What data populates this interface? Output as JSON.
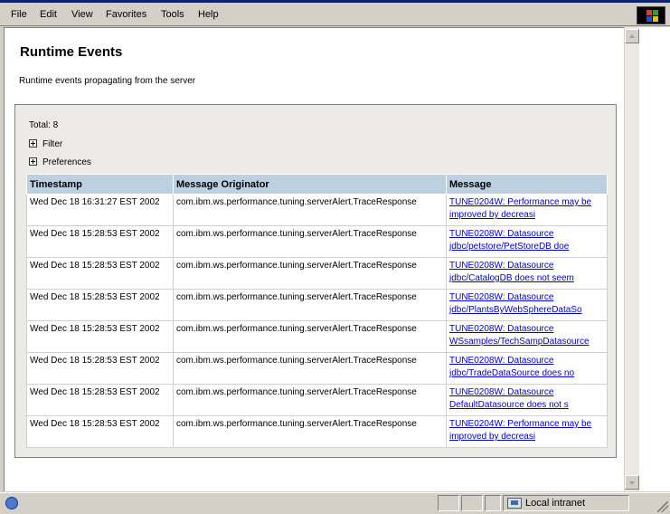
{
  "menu": {
    "file": "File",
    "edit": "Edit",
    "view": "View",
    "favorites": "Favorites",
    "tools": "Tools",
    "help": "Help"
  },
  "page": {
    "title": "Runtime Events",
    "description": "Runtime events propagating from the server"
  },
  "panel": {
    "total": "Total: 8",
    "filter_label": "Filter",
    "preferences_label": "Preferences"
  },
  "table": {
    "headers": [
      "Timestamp",
      "Message Originator",
      "Message"
    ],
    "rows": [
      {
        "timestamp": "Wed Dec 18 16:31:27 EST 2002",
        "originator": "com.ibm.ws.performance.tuning.serverAlert.TraceResponse",
        "message": "TUNE0204W: Performance may be improved by decreasi"
      },
      {
        "timestamp": "Wed Dec 18 15:28:53 EST 2002",
        "originator": "com.ibm.ws.performance.tuning.serverAlert.TraceResponse",
        "message": "TUNE0208W: Datasource jdbc/petstore/PetStoreDB doe"
      },
      {
        "timestamp": "Wed Dec 18 15:28:53 EST 2002",
        "originator": "com.ibm.ws.performance.tuning.serverAlert.TraceResponse",
        "message": "TUNE0208W: Datasource jdbc/CatalogDB does not seem"
      },
      {
        "timestamp": "Wed Dec 18 15:28:53 EST 2002",
        "originator": "com.ibm.ws.performance.tuning.serverAlert.TraceResponse",
        "message": "TUNE0208W: Datasource jdbc/PlantsByWebSphereDataSo"
      },
      {
        "timestamp": "Wed Dec 18 15:28:53 EST 2002",
        "originator": "com.ibm.ws.performance.tuning.serverAlert.TraceResponse",
        "message": "TUNE0208W: Datasource WSsamples/TechSampDatasource"
      },
      {
        "timestamp": "Wed Dec 18 15:28:53 EST 2002",
        "originator": "com.ibm.ws.performance.tuning.serverAlert.TraceResponse",
        "message": "TUNE0208W: Datasource jdbc/TradeDataSource does no"
      },
      {
        "timestamp": "Wed Dec 18 15:28:53 EST 2002",
        "originator": "com.ibm.ws.performance.tuning.serverAlert.TraceResponse",
        "message": "TUNE0208W: Datasource DefaultDatasource does not s"
      },
      {
        "timestamp": "Wed Dec 18 15:28:53 EST 2002",
        "originator": "com.ibm.ws.performance.tuning.serverAlert.TraceResponse",
        "message": "TUNE0204W: Performance may be improved by decreasi"
      }
    ]
  },
  "status": {
    "zone": "Local intranet"
  },
  "icons": {
    "browser_logo": "windows-flag-icon",
    "page_status": "ie-page-icon",
    "zone": "intranet-zone-icon",
    "expand": "plus-box-icon"
  },
  "colors": {
    "header_bg": "#bcd0e0",
    "link": "#0000cc",
    "panel_bg": "#eceae6"
  }
}
